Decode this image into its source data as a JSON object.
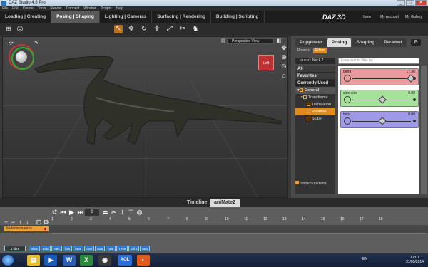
{
  "window": {
    "title": "DAZ Studio 4.6 Pro"
  },
  "menubar": [
    "File",
    "Edit",
    "Create",
    "Tools",
    "Render",
    "Connect",
    "Window",
    "Scripts",
    "Help"
  ],
  "rooms": [
    {
      "label": "Loading | Creating",
      "active": false
    },
    {
      "label": "Posing | Shaping",
      "active": true
    },
    {
      "label": "Lighting | Cameras",
      "active": false
    },
    {
      "label": "Surfacing | Rendering",
      "active": false
    },
    {
      "label": "Building | Scripting",
      "active": false
    }
  ],
  "brand": "DAZ 3D",
  "toplinks": {
    "home": "Home",
    "account": "My Account",
    "gallery": "My Gallery"
  },
  "viewport": {
    "camera": "Perspective View",
    "navcube_label": "Left"
  },
  "rightpane": {
    "tabs": [
      "Puppeteer",
      "Posing",
      "Shaping",
      "Paramet"
    ],
    "subtabs": [
      "Presets",
      "Editor"
    ],
    "breadcrumb": "...aurus : Neck 2",
    "filter_placeholder": "Enter text to filter by...",
    "quick": [
      "All",
      "Favorites",
      "Currently Used"
    ],
    "tree": {
      "general": "General",
      "transforms": "Transforms",
      "translation": "Translation",
      "rotation": "Rotation",
      "scale": "Scale"
    },
    "show_sub": "Show Sub Items",
    "sliders": [
      {
        "name": "bend",
        "value": "17.36",
        "color": "#e89a9e",
        "knob": 0.98
      },
      {
        "name": "side-side",
        "value": "0.00",
        "color": "#a6e39a",
        "knob": 0.5
      },
      {
        "name": "twist",
        "value": "0.00",
        "color": "#9e9ae8",
        "knob": 0.5
      }
    ]
  },
  "bottomtabs": [
    "Timeline",
    "aniMate2"
  ],
  "timeline": {
    "ticks": [
      "1",
      "2",
      "3",
      "4",
      "5",
      "6",
      "7",
      "8",
      "9",
      "10",
      "11",
      "12",
      "13",
      "14",
      "15",
      "16",
      "17",
      "18"
    ],
    "track": "Melanorosaurus",
    "frame_field": "0",
    "clips": [
      "1 fibre",
      "Blow",
      "eatc",
      "eatc",
      "fors",
      "hear",
      "roar",
      "roar",
      "roar",
      "T-Re",
      "tail s",
      "turn"
    ]
  },
  "taskbar": {
    "lang": "EN",
    "time": "17:07",
    "date": "31/05/2014"
  }
}
